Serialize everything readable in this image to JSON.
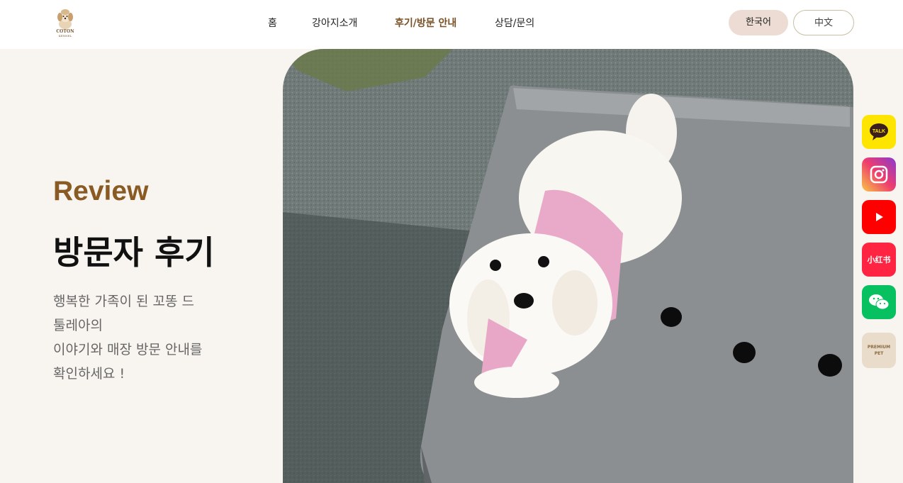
{
  "logo": {
    "line1": "COTON",
    "line2": "KENNEL"
  },
  "nav": {
    "items": [
      {
        "label": "홈"
      },
      {
        "label": "강아지소개"
      },
      {
        "label": "후기/방문 안내"
      },
      {
        "label": "상담/문의"
      }
    ],
    "active_index": 2
  },
  "languages": {
    "korean": "한국어",
    "chinese": "中文"
  },
  "hero": {
    "eyebrow": "Review",
    "title": "방문자 후기",
    "description_lines": [
      "행복한 가족이 된 꼬똥 드",
      "툴레아의",
      "이야기와 매장 방문 안내를",
      "확인하세요 !"
    ]
  },
  "side_links": {
    "kakao_label": "TALK",
    "xiaohongshu_label": "小红书",
    "premium_line1": "PREMIUM",
    "premium_line2": "PET"
  },
  "colors": {
    "accent_brown": "#8a5a24",
    "page_bg": "#f8f5f0",
    "kakao_yellow": "#fde500",
    "youtube_red": "#ff0000",
    "wechat_green": "#07c160"
  }
}
